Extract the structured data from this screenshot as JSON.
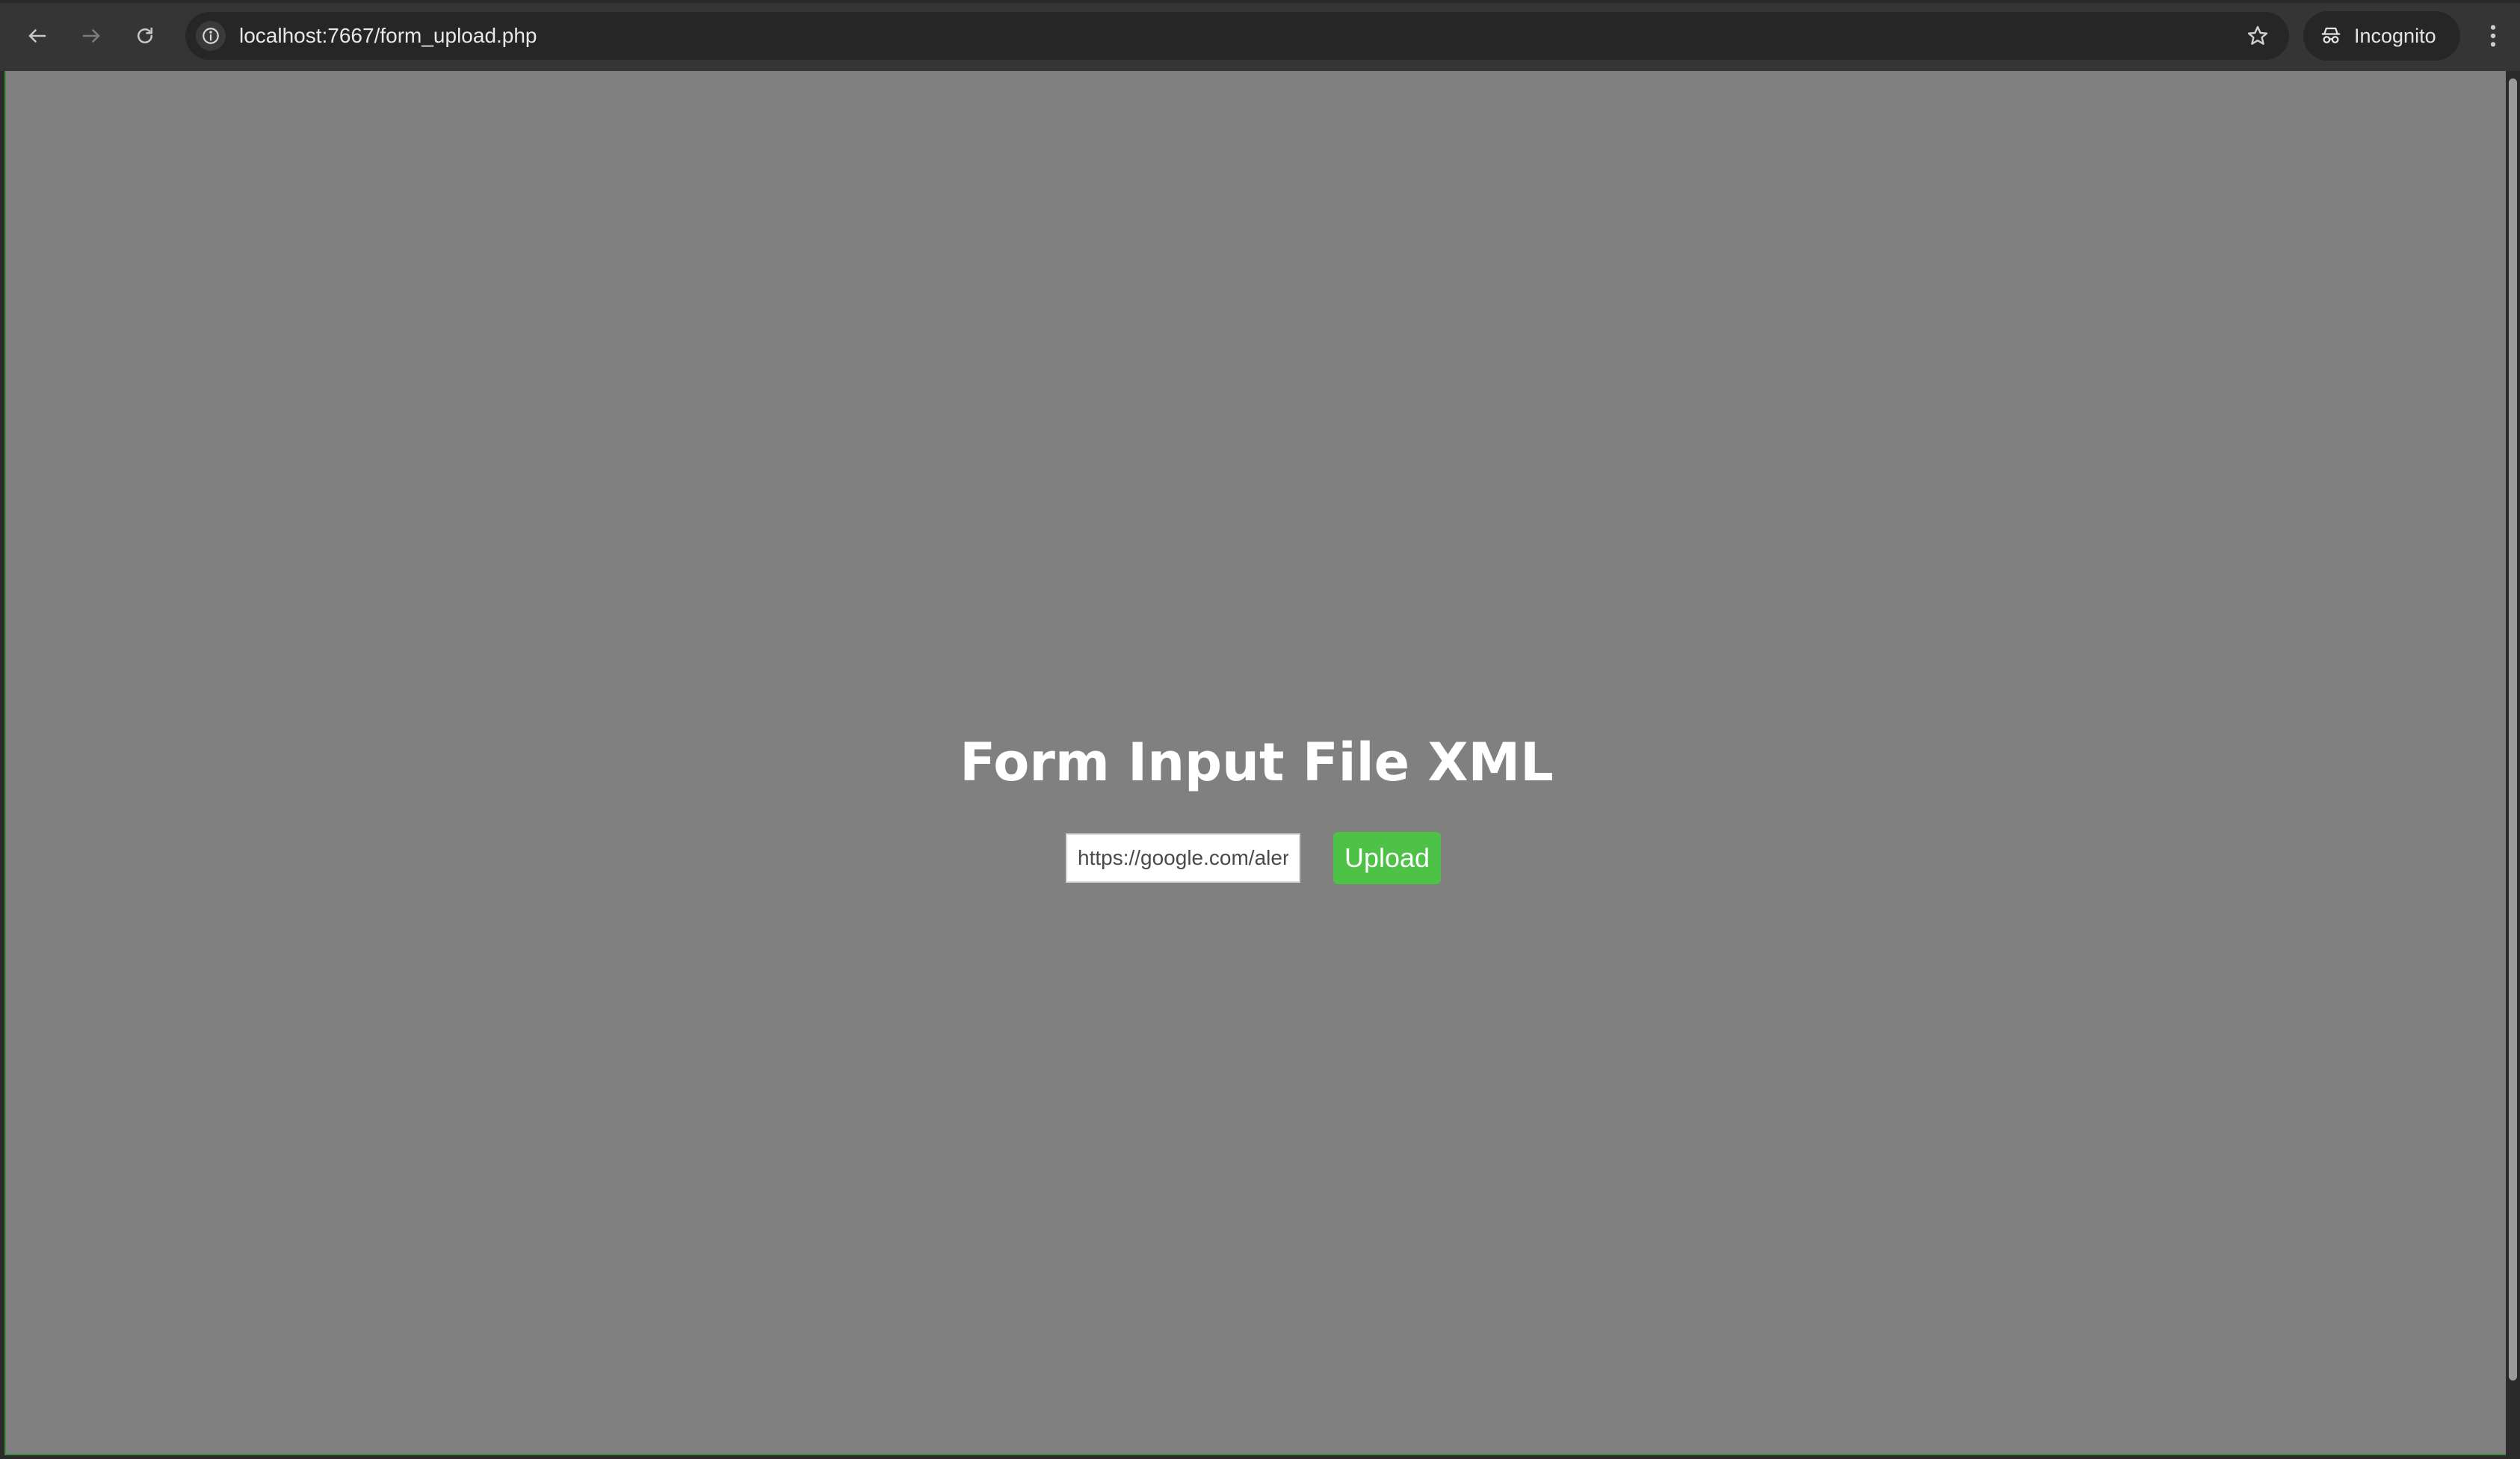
{
  "browser": {
    "address_bar": {
      "url": "localhost:7667/form_upload.php"
    },
    "profile_chip": {
      "label": "Incognito"
    },
    "icons": {
      "back": "arrow-left-icon",
      "forward": "arrow-right-icon",
      "reload": "reload-icon",
      "site_info": "info-icon",
      "bookmark": "star-icon",
      "incognito": "incognito-icon",
      "menu": "kebab-menu-icon"
    }
  },
  "page": {
    "background_color": "#808080",
    "title": "Form Input File XML",
    "form": {
      "url_input": {
        "value": "https://google.com/alert"
      },
      "submit": {
        "label": "Upload",
        "color": "#4dc247"
      }
    }
  }
}
